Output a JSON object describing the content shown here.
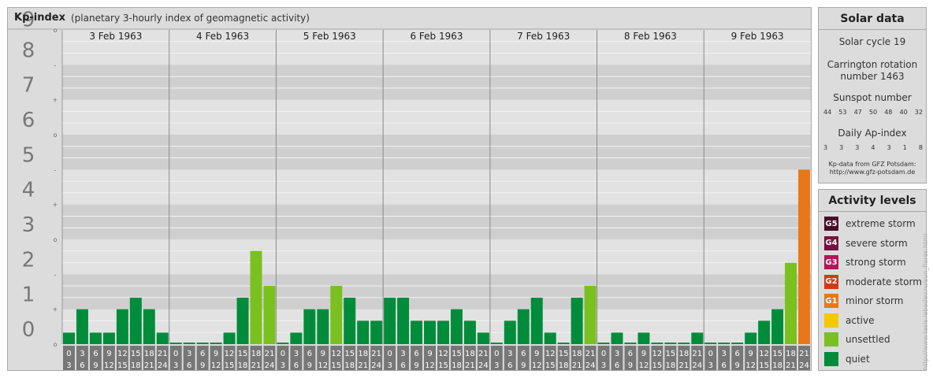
{
  "header": {
    "title": "Kp-index",
    "subtitle": "(planetary 3-hourly index of geomagnetic activity)"
  },
  "chart_data": {
    "type": "bar",
    "title": "Kp-index",
    "subtitle": "(planetary 3-hourly index of geomagnetic activity)",
    "ylim": [
      0,
      9
    ],
    "y_major_ticks": [
      "0",
      "1",
      "2",
      "3",
      "4",
      "5",
      "6",
      "7",
      "8",
      "9"
    ],
    "y_minor_ticks": [
      "o",
      "+",
      "-",
      "o"
    ],
    "grid": true,
    "days": [
      "3 Feb 1963",
      "4 Feb 1963",
      "5 Feb 1963",
      "6 Feb 1963",
      "7 Feb 1963",
      "8 Feb 1963",
      "9 Feb 1963"
    ],
    "intervals": [
      {
        "start": "0",
        "end": "3"
      },
      {
        "start": "3",
        "end": "6"
      },
      {
        "start": "6",
        "end": "9"
      },
      {
        "start": "9",
        "end": "12"
      },
      {
        "start": "12",
        "end": "15"
      },
      {
        "start": "15",
        "end": "18"
      },
      {
        "start": "18",
        "end": "21"
      },
      {
        "start": "21",
        "end": "24"
      }
    ],
    "values": [
      [
        0.33,
        1.0,
        0.33,
        0.33,
        1.0,
        1.33,
        1.0,
        0.33
      ],
      [
        0.0,
        0.0,
        0.0,
        0.0,
        0.33,
        1.33,
        2.67,
        1.67
      ],
      [
        0.0,
        0.33,
        1.0,
        1.0,
        1.67,
        1.33,
        0.67,
        0.67
      ],
      [
        1.33,
        1.33,
        0.67,
        0.67,
        0.67,
        1.0,
        0.67,
        0.33
      ],
      [
        0.0,
        0.67,
        1.0,
        1.33,
        0.33,
        0.0,
        1.33,
        1.67
      ],
      [
        0.0,
        0.33,
        0.0,
        0.33,
        0.0,
        0.0,
        0.0,
        0.33
      ],
      [
        0.0,
        0.0,
        0.0,
        0.33,
        0.67,
        1.0,
        2.33,
        5.0
      ]
    ],
    "level_colors": {
      "quiet": "#008c3a",
      "unsettled": "#7ac01f",
      "active": "#f5c800",
      "minor": "#e87817"
    }
  },
  "solar": {
    "title": "Solar data",
    "cycle": "Solar cycle 19",
    "carrington_line1": "Carrington rotation",
    "carrington_line2": "number 1463",
    "sunspot_title": "Sunspot number",
    "sunspot": [
      "44",
      "53",
      "47",
      "50",
      "48",
      "40",
      "32"
    ],
    "ap_title": "Daily Ap-index",
    "ap": [
      "3",
      "3",
      "3",
      "4",
      "3",
      "1",
      "8"
    ],
    "source_line1": "Kp-data from GFZ Potsdam:",
    "source_line2": "http://www.gfz-potsdam.de"
  },
  "levels": {
    "title": "Activity levels",
    "items": [
      {
        "badge": "G5",
        "label": "extreme storm",
        "color": "#4a0a2a"
      },
      {
        "badge": "G4",
        "label": "severe storm",
        "color": "#7a1040"
      },
      {
        "badge": "G3",
        "label": "strong storm",
        "color": "#b4145a"
      },
      {
        "badge": "G2",
        "label": "moderate storm",
        "color": "#d03a1a"
      },
      {
        "badge": "G1",
        "label": "minor storm",
        "color": "#e87817"
      },
      {
        "badge": "",
        "label": "active",
        "color": "#f5c800"
      },
      {
        "badge": "",
        "label": "unsettled",
        "color": "#7ac01f"
      },
      {
        "badge": "",
        "label": "quiet",
        "color": "#008c3a"
      }
    ]
  },
  "credit": "http://www.tesis.lebedev.ru/sun_flares.html"
}
